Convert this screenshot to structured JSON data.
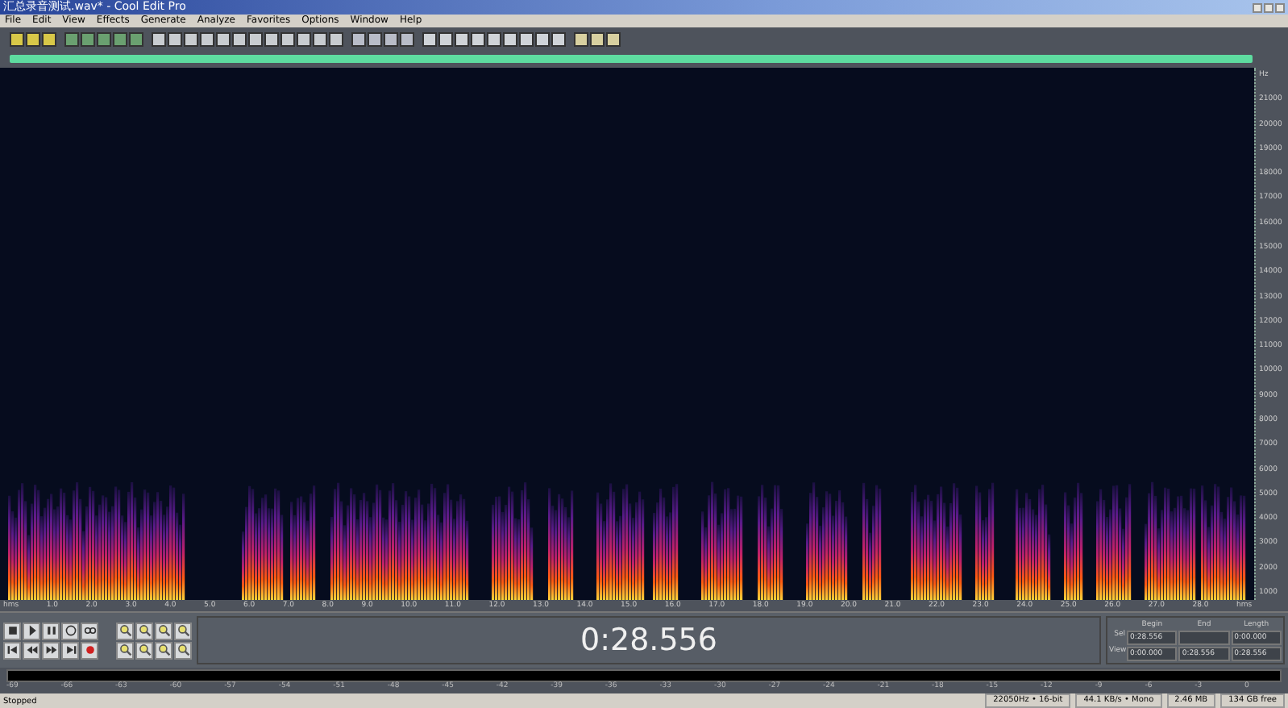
{
  "window": {
    "title": "汇总录音测试.wav* - Cool Edit Pro"
  },
  "menu": [
    "File",
    "Edit",
    "View",
    "Effects",
    "Generate",
    "Analyze",
    "Favorites",
    "Options",
    "Window",
    "Help"
  ],
  "frequency_axis": {
    "unit": "Hz",
    "labels": [
      "21000",
      "20000",
      "19000",
      "18000",
      "17000",
      "16000",
      "15000",
      "14000",
      "13000",
      "12000",
      "11000",
      "10000",
      "9000",
      "8000",
      "7000",
      "6000",
      "5000",
      "4000",
      "3000",
      "2000",
      "1000"
    ]
  },
  "time_ruler": {
    "start": "hms",
    "end": "hms",
    "labels": [
      "1.0",
      "2.0",
      "3.0",
      "4.0",
      "5.0",
      "6.0",
      "7.0",
      "8.0",
      "9.0",
      "10.0",
      "11.0",
      "12.0",
      "13.0",
      "14.0",
      "15.0",
      "16.0",
      "17.0",
      "18.0",
      "19.0",
      "20.0",
      "21.0",
      "22.0",
      "23.0",
      "24.0",
      "25.0",
      "26.0",
      "27.0",
      "28.0"
    ]
  },
  "time_display": "0:28.556",
  "selection": {
    "columns": [
      "Begin",
      "End",
      "Length"
    ],
    "rows": [
      {
        "label": "Sel",
        "begin": "0:28.556",
        "length": "0:00.000"
      },
      {
        "label": "View",
        "begin": "0:00.000",
        "end": "0:28.556",
        "length": "0:28.556"
      }
    ]
  },
  "level_meter": {
    "ticks": [
      "-69",
      "-66",
      "-63",
      "-60",
      "-57",
      "-54",
      "-51",
      "-48",
      "-45",
      "-42",
      "-39",
      "-36",
      "-33",
      "-30",
      "-27",
      "-24",
      "-21",
      "-18",
      "-15",
      "-12",
      "-9",
      "-6",
      "-3",
      "0"
    ]
  },
  "status_bar": {
    "state": "Stopped",
    "fields": [
      "22050Hz • 16-bit",
      "44.1 KB/s • Mono",
      "2.46 MB",
      "134 GB free"
    ]
  }
}
